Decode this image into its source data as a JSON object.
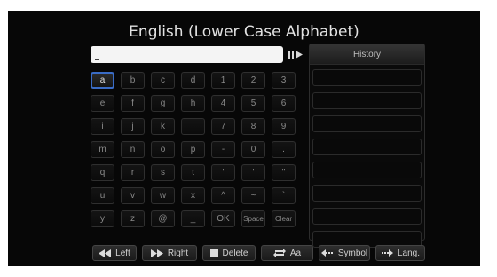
{
  "title": "English (Lower Case Alphabet)",
  "input": {
    "value": ""
  },
  "history": {
    "header": "History",
    "slot_count": 8
  },
  "keyboard": {
    "selected": "a",
    "keys": [
      [
        "a",
        "b",
        "c",
        "d",
        "1",
        "2",
        "3"
      ],
      [
        "e",
        "f",
        "g",
        "h",
        "4",
        "5",
        "6"
      ],
      [
        "i",
        "j",
        "k",
        "l",
        "7",
        "8",
        "9"
      ],
      [
        "m",
        "n",
        "o",
        "p",
        "-",
        "0",
        "."
      ],
      [
        "q",
        "r",
        "s",
        "t",
        "'",
        "'",
        "\""
      ],
      [
        "u",
        "v",
        "w",
        "x",
        "^",
        "~",
        "`"
      ],
      [
        "y",
        "z",
        "@",
        "_",
        "OK",
        "Space",
        "Clear"
      ]
    ]
  },
  "bottom_bar": [
    {
      "label": "Left",
      "icon": "rewind-icon"
    },
    {
      "label": "Right",
      "icon": "fast-forward-icon"
    },
    {
      "label": "Delete",
      "icon": "stop-icon"
    },
    {
      "label": "Aa",
      "icon": "repeat-icon"
    },
    {
      "label": "Symbol",
      "icon": "arrow-left-icon"
    },
    {
      "label": "Lang.",
      "icon": "arrow-right-icon"
    }
  ],
  "colors": {
    "selection": "#3a6cc6",
    "background": "#070707"
  }
}
